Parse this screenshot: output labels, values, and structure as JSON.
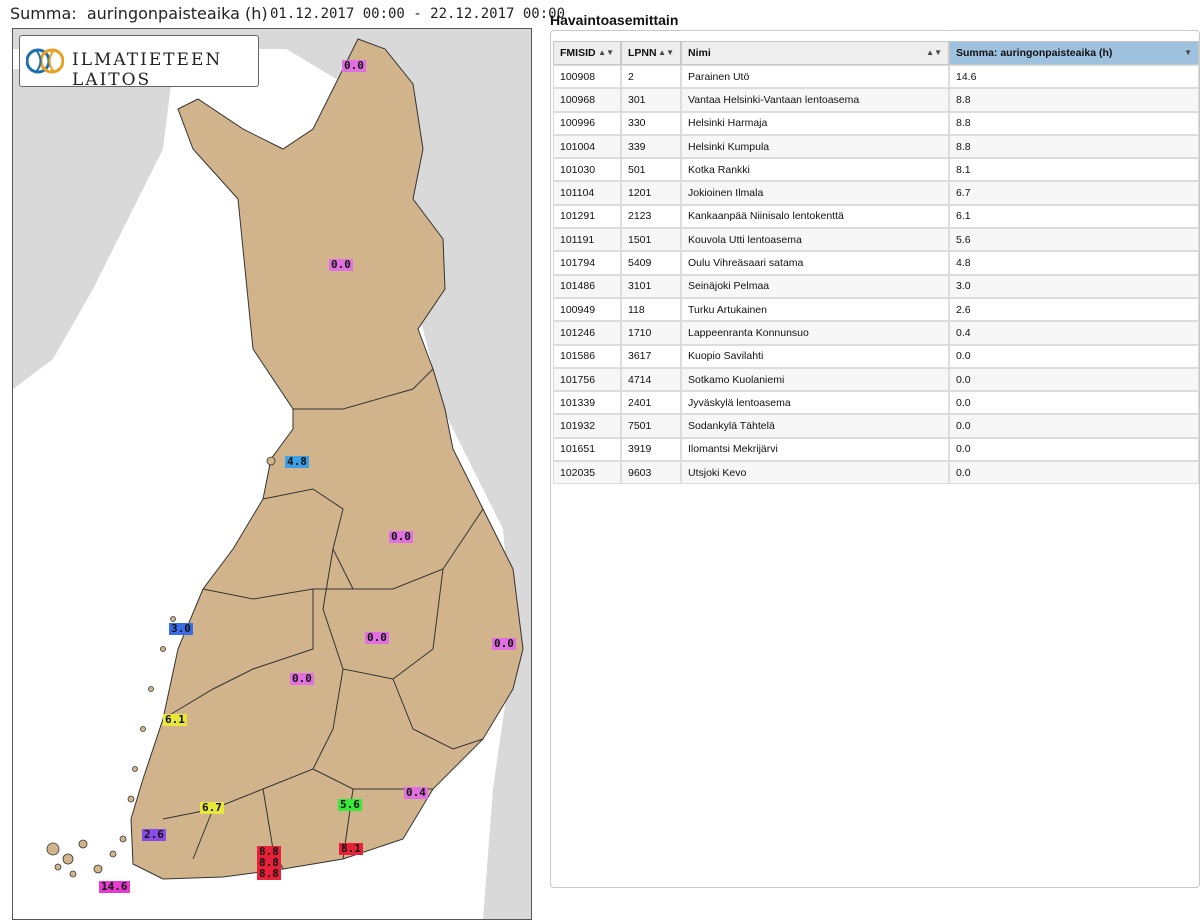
{
  "map": {
    "title": "Summa:  auringonpaisteaika (h)",
    "date_range": "01.12.2017 00:00 - 22.12.2017 00:00",
    "logo_text": "ILMATIETEEN LAITOS",
    "labels": [
      {
        "value": "0.0",
        "color": "#e070e0"
      },
      {
        "value": "0.0",
        "color": "#e070e0"
      },
      {
        "value": "4.8",
        "color": "#3aa0e8"
      },
      {
        "value": "0.0",
        "color": "#e070e0"
      },
      {
        "value": "3.0",
        "color": "#3a6ce8"
      },
      {
        "value": "0.0",
        "color": "#e070e0"
      },
      {
        "value": "0.0",
        "color": "#e070e0"
      },
      {
        "value": "0.0",
        "color": "#e070e0"
      },
      {
        "value": "6.1",
        "color": "#e8e83a"
      },
      {
        "value": "0.4",
        "color": "#e070e0"
      },
      {
        "value": "5.6",
        "color": "#3ae83a"
      },
      {
        "value": "6.7",
        "color": "#e8e83a"
      },
      {
        "value": "2.6",
        "color": "#8a4ae8"
      },
      {
        "value": "8.8",
        "color": "#e8203a"
      },
      {
        "value": "8.8",
        "color": "#e8203a"
      },
      {
        "value": "8.8",
        "color": "#e8203a"
      },
      {
        "value": "8.1",
        "color": "#e8203a"
      },
      {
        "value": "14.6",
        "color": "#e83ad0"
      }
    ]
  },
  "panel": {
    "title": "Havaintoasemittain",
    "columns": [
      "FMISID",
      "LPNN",
      "Nimi",
      "Summa: auringonpaisteaika (h)"
    ],
    "rows": [
      [
        "100908",
        "2",
        "Parainen Utö",
        "14.6"
      ],
      [
        "100968",
        "301",
        "Vantaa Helsinki-Vantaan lentoasema",
        "8.8"
      ],
      [
        "100996",
        "330",
        "Helsinki Harmaja",
        "8.8"
      ],
      [
        "101004",
        "339",
        "Helsinki Kumpula",
        "8.8"
      ],
      [
        "101030",
        "501",
        "Kotka Rankki",
        "8.1"
      ],
      [
        "101104",
        "1201",
        "Jokioinen Ilmala",
        "6.7"
      ],
      [
        "101291",
        "2123",
        "Kankaanpää Niinisalo lentokenttä",
        "6.1"
      ],
      [
        "101191",
        "1501",
        "Kouvola Utti lentoasema",
        "5.6"
      ],
      [
        "101794",
        "5409",
        "Oulu Vihreäsaari satama",
        "4.8"
      ],
      [
        "101486",
        "3101",
        "Seinäjoki Pelmaa",
        "3.0"
      ],
      [
        "100949",
        "118",
        "Turku Artukainen",
        "2.6"
      ],
      [
        "101246",
        "1710",
        "Lappeenranta Konnunsuo",
        "0.4"
      ],
      [
        "101586",
        "3617",
        "Kuopio Savilahti",
        "0.0"
      ],
      [
        "101756",
        "4714",
        "Sotkamo Kuolaniemi",
        "0.0"
      ],
      [
        "101339",
        "2401",
        "Jyväskylä lentoasema",
        "0.0"
      ],
      [
        "101932",
        "7501",
        "Sodankylä Tähtelä",
        "0.0"
      ],
      [
        "101651",
        "3919",
        "Ilomantsi Mekrijärvi",
        "0.0"
      ],
      [
        "102035",
        "9603",
        "Utsjoki Kevo",
        "0.0"
      ]
    ]
  }
}
